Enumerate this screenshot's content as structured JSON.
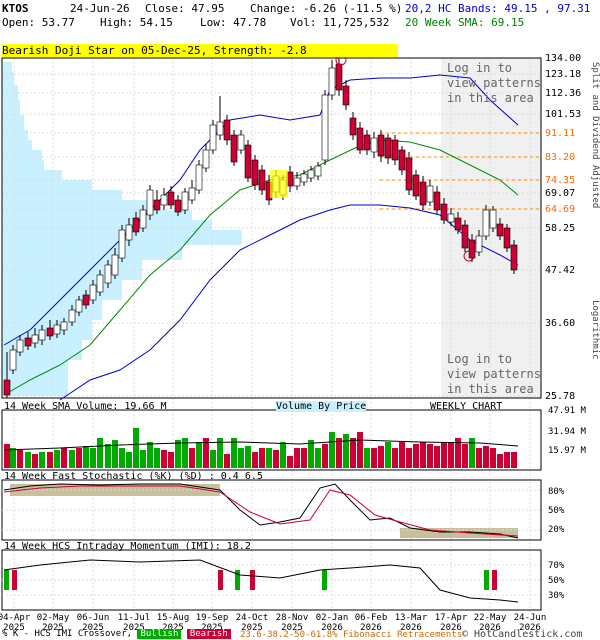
{
  "header": {
    "ticker": "KTOS",
    "date": "24-Jun-26",
    "close_label": "Close: 47.95",
    "change_label": "Change: -6.26 (-11.5 %)",
    "open_label": "Open: 53.77",
    "high_label": "High: 54.15",
    "low_label": "Low: 47.78",
    "vol_label": "Vol: 11,725,532",
    "hc_bands": "20,2 HC Bands: 49.15 , 97.31",
    "sma20": "20 Week SMA: 69.15"
  },
  "signal_banner": "Bearish Doji Star on 05-Dec-25, Strength: -2.8",
  "login_prompt": "Log in to view patterns in this area",
  "price_axis": [
    "134.00",
    "123.18",
    "112.36",
    "101.53",
    "91.11",
    "83.20",
    "74.35",
    "69.07",
    "64.69",
    "58.25",
    "47.42",
    "36.60",
    "25.78"
  ],
  "right_axis_label": "Split and Dividend Adjusted",
  "right_axis_scale": "Logarithmic",
  "volume_panel": {
    "title": "14 Week SMA Volume: 19.66 M",
    "center_label": "Volume By Price",
    "right_label": "WEEKLY CHART",
    "ticks": [
      "47.91 M",
      "31.94 M",
      "15.97 M"
    ]
  },
  "stoch_panel": {
    "title": "14 Week Fast Stochastic (%K) (%D) : 0.4  6.5",
    "ticks": [
      "80%",
      "50%",
      "20%"
    ]
  },
  "momentum_panel": {
    "title": "14 Week HCS Intraday Momentum (IMI): 18.2",
    "ticks": [
      "70%",
      "50%",
      "30%"
    ]
  },
  "x_labels": [
    [
      "04-Apr",
      "2025"
    ],
    [
      "02-May",
      "2025"
    ],
    [
      "06-Jun",
      "2025"
    ],
    [
      "11-Jul",
      "2025"
    ],
    [
      "15-Aug",
      "2025"
    ],
    [
      "19-Sep",
      "2025"
    ],
    [
      "24-Oct",
      "2025"
    ],
    [
      "28-Nov",
      "2025"
    ],
    [
      "02-Jan",
      "2026"
    ],
    [
      "06-Feb",
      "2026"
    ],
    [
      "13-Mar",
      "2026"
    ],
    [
      "17-Apr",
      "2026"
    ],
    [
      "22-May",
      "2026"
    ],
    [
      "24-Jun",
      "2026"
    ]
  ],
  "footer": {
    "crossover_label": "% K - HCS IMI Crossover,",
    "bullish": "Bullish",
    "bearish": "Bearish",
    "fibonacci": "23.6-38.2-50-61.8% Fibonacci Retracements",
    "copyright": "© HotCandlestick.com"
  },
  "colors": {
    "bull": "#00aa00",
    "bear": "#cc0033",
    "upper_band": "#0000cc",
    "sma": "#008800",
    "volume_profile": "#c8f0ff",
    "fib_line": "#ff8800",
    "doji_highlight": "#ffff00"
  }
}
